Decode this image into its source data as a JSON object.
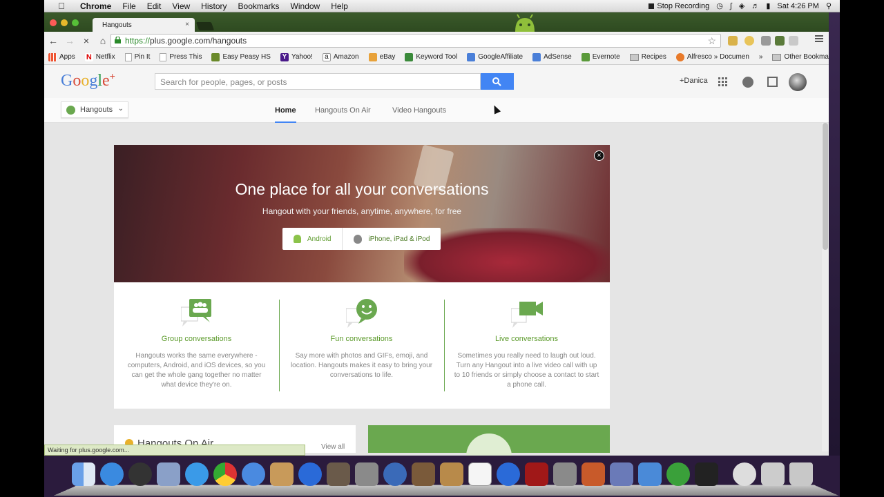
{
  "menubar": {
    "app_name": "Chrome",
    "items": [
      "File",
      "Edit",
      "View",
      "History",
      "Bookmarks",
      "Window",
      "Help"
    ],
    "stop_recording": "Stop Recording",
    "clock": "Sat 4:26 PM"
  },
  "browser": {
    "tab_title": "Hangouts",
    "tab_close": "×",
    "url_scheme": "https://",
    "url_rest": "plus.google.com/hangouts",
    "bookmarks": [
      "Apps",
      "Netflix",
      "Pin It",
      "Press This",
      "Easy Peasy HS",
      "Yahoo!",
      "Amazon",
      "eBay",
      "Keyword Tool",
      "GoogleAffiliate",
      "AdSense",
      "Evernote",
      "Recipes",
      "Alfresco » Documen"
    ],
    "other_bookmarks": "Other Bookmarks",
    "overflow": "»",
    "status": "Waiting for plus.google.com..."
  },
  "gplus": {
    "logo_parts": [
      "G",
      "o",
      "o",
      "g",
      "l",
      "e"
    ],
    "logo_plus": "+",
    "search_placeholder": "Search for people, pages, or posts",
    "user_name": "+Danica",
    "product": "Hangouts",
    "tabs": [
      "Home",
      "Hangouts On Air",
      "Video Hangouts"
    ]
  },
  "promo": {
    "title": "One place for all your conversations",
    "subtitle": "Hangout with your friends, anytime, anywhere, for free",
    "close": "×",
    "android_label": "Android",
    "ios_label": "iPhone, iPad & iPod",
    "features": [
      {
        "title": "Group conversations",
        "desc": "Hangouts works the same everywhere - computers, Android, and iOS devices, so you can get the whole gang together no matter what device they're on.",
        "icon": "group-chat-icon"
      },
      {
        "title": "Fun conversations",
        "desc": "Say more with photos and GIFs, emoji, and location. Hangouts makes it easy to bring your conversations to life.",
        "icon": "smiley-chat-icon"
      },
      {
        "title": "Live conversations",
        "desc": "Sometimes you really need to laugh out loud. Turn any Hangout into a live video call with up to 10 friends or simply choose a contact to start a phone call.",
        "icon": "video-chat-icon"
      }
    ]
  },
  "onair": {
    "title": "Hangouts On Air",
    "view_all": "View all"
  },
  "colors": {
    "accent_green": "#6aa84f",
    "google_blue": "#4285f4"
  }
}
